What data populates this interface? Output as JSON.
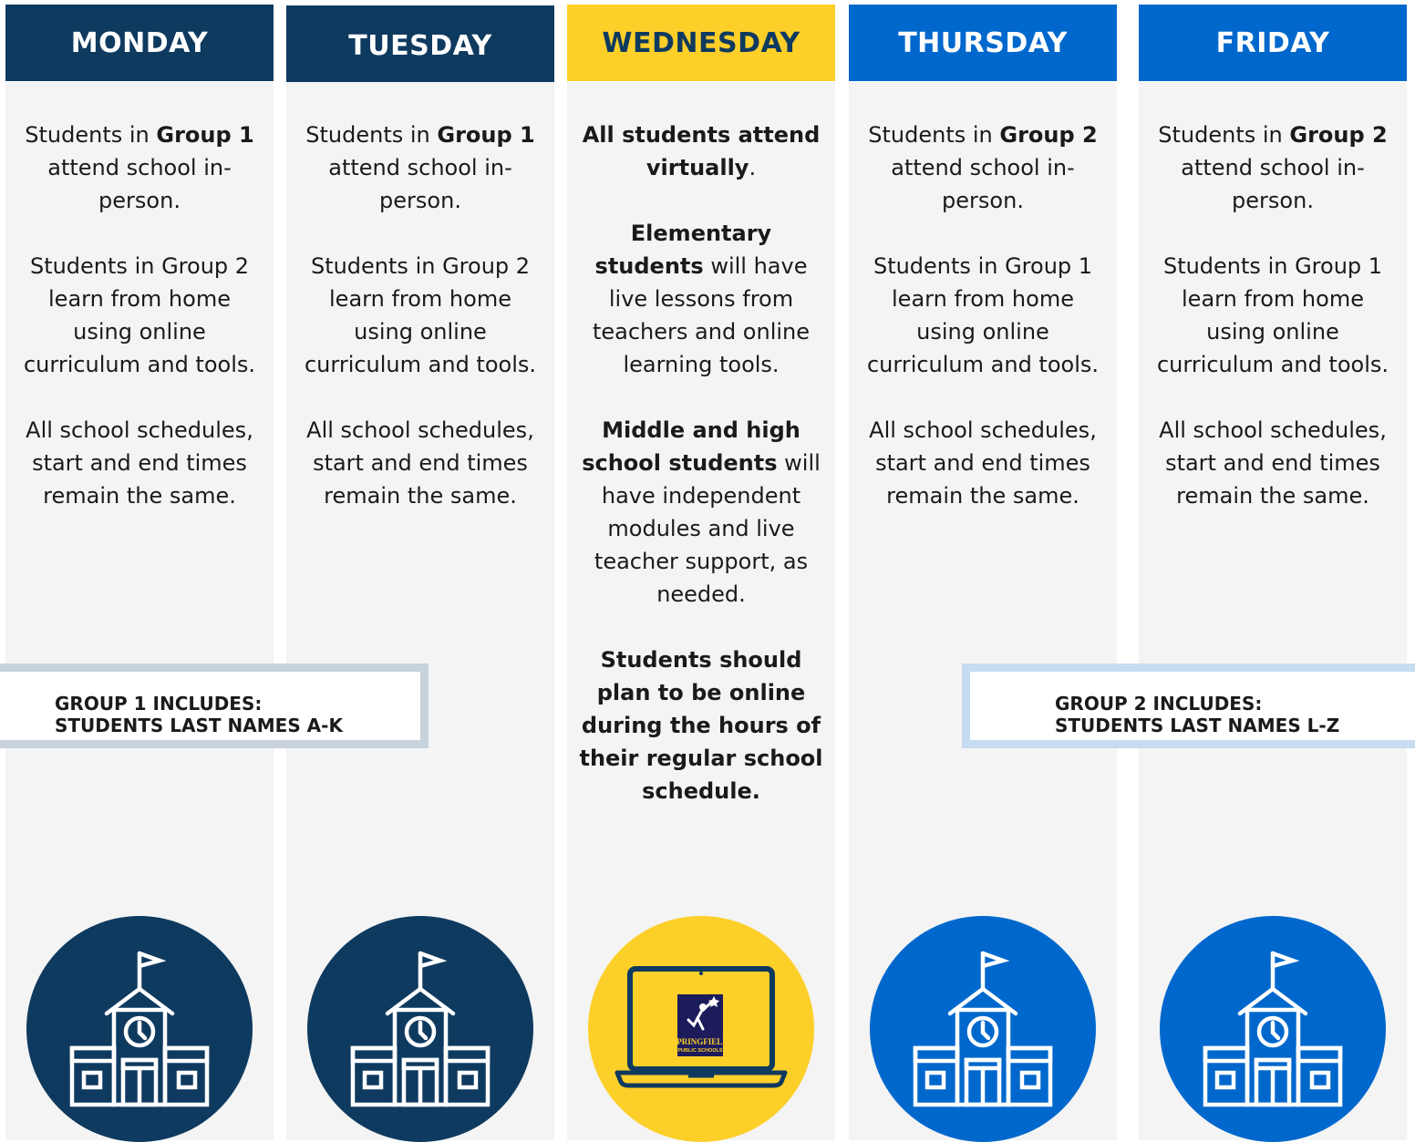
{
  "colors": {
    "navy": "#0f3a5f",
    "gold": "#fdcf29",
    "blue": "#0068cc",
    "group1_border": "#c7d2dc",
    "group2_border": "#c6dcf0",
    "panel_bg": "#f4f4f4"
  },
  "days": [
    {
      "header": "MONDAY",
      "p1_pre": "Students in ",
      "p1_bold": "Group 1",
      "p1_post": " attend school in-person.",
      "p2": "Students in Group 2 learn from home using online curriculum and tools.",
      "p3": "All school schedules, start and end times remain the same.",
      "icon": "school-building-icon"
    },
    {
      "header": "TUESDAY",
      "p1_pre": "Students in ",
      "p1_bold": "Group 1",
      "p1_post": " attend school in-person.",
      "p2": "Students in Group 2 learn from home using online curriculum and tools.",
      "p3": "All school schedules, start and end times remain the same.",
      "icon": "school-building-icon"
    },
    {
      "header": "WEDNESDAY",
      "p1_bold": "All students attend virtually",
      "p1_post": ".",
      "p2_bold": "Elementary students",
      "p2_post": " will have live lessons from teachers and online learning tools.",
      "p3_bold": "Middle and high school students",
      "p3_post": " will have independent modules and live teacher support, as needed.",
      "p4_bold": "Students should plan to be online during the hours of their regular school schedule.",
      "icon": "laptop-icon",
      "logo_line1": "SPRINGFIELD",
      "logo_line2": "PUBLIC SCHOOLS"
    },
    {
      "header": "THURSDAY",
      "p1_pre": "Students in ",
      "p1_bold": "Group 2",
      "p1_post": " attend school in-person.",
      "p2": "Students in Group 1 learn from home using online curriculum and tools.",
      "p3": "All school schedules, start and end times remain the same.",
      "icon": "school-building-icon"
    },
    {
      "header": "FRIDAY",
      "p1_pre": "Students in ",
      "p1_bold": "Group 2",
      "p1_post": " attend school in-person.",
      "p2": "Students in Group 1 learn from home using online curriculum and tools.",
      "p3": "All school schedules, start and end times remain the same.",
      "icon": "school-building-icon"
    }
  ],
  "group1": {
    "line1": "GROUP 1 INCLUDES:",
    "line2": "STUDENTS LAST NAMES A-K"
  },
  "group2": {
    "line1": "GROUP 2 INCLUDES:",
    "line2": "STUDENTS LAST NAMES L-Z"
  }
}
